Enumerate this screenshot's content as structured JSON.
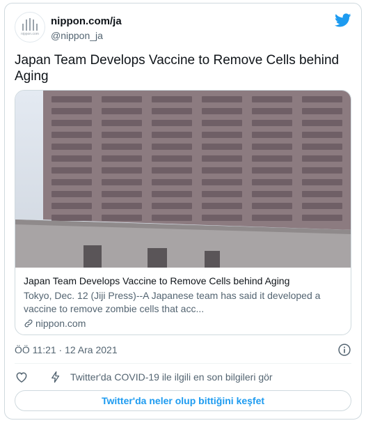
{
  "author": {
    "display_name": "nippon.com/ja",
    "handle": "@nippon_ja",
    "avatar_icon": "nippon-logo-icon"
  },
  "tweet": {
    "text": "Japan Team Develops Vaccine to Remove Cells behind Aging",
    "timestamp": "ÖÖ 11:21 · 12 Ara 2021"
  },
  "card": {
    "title": "Japan Team Develops Vaccine to Remove Cells behind Aging",
    "description": "Tokyo, Dec. 12 (Jiji Press)--A Japanese team has said it developed a vaccine to remove zombie cells that acc...",
    "domain": "nippon.com",
    "image_icon": "building-photo"
  },
  "actions": {
    "like_icon": "heart-icon",
    "covid_icon": "bolt-icon",
    "covid_text": "Twitter'da COVID-19 ile ilgili en son bilgileri gör"
  },
  "explore_button": "Twitter'da neler olup bittiğini keşfet",
  "colors": {
    "accent": "#1d9bf0",
    "muted": "#536471",
    "border": "#cfd9de"
  }
}
